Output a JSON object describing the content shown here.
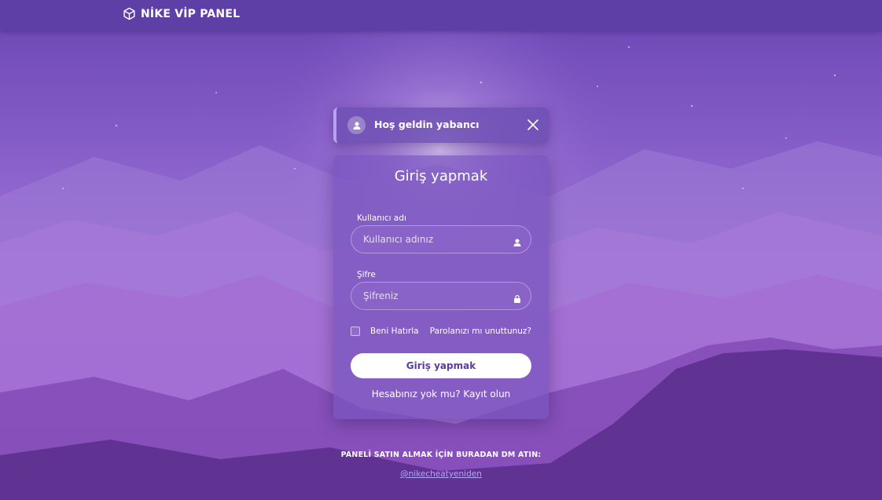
{
  "app": {
    "brand": "NİKE VİP PANEL"
  },
  "toast": {
    "message": "Hoş geldin yabancı"
  },
  "login": {
    "title": "Giriş yapmak",
    "username_label": "Kullanıcı adı",
    "username_placeholder": "Kullanıcı adınız",
    "username_value": "",
    "password_label": "Şifre",
    "password_placeholder": "Şifreniz",
    "password_value": "",
    "remember_label": "Beni Hatırla",
    "remember_checked": false,
    "forgot_label": "Parolanızı mı unuttunuz?",
    "submit_label": "Giriş yapmak",
    "register_label": "Hesabınız yok mu? Kayıt olun"
  },
  "footer": {
    "note": "PANELİ SATIN ALMAK İÇİN BURADAN DM ATIN:",
    "link": "@nikecheatyeniden"
  },
  "icons": {
    "brand": "cube-icon",
    "toast_avatar": "user-icon",
    "toast_close": "close-icon",
    "username_field": "user-icon",
    "password_field": "lock-icon"
  },
  "colors": {
    "topbar": "#5e3fa6",
    "accent": "#b7a1f0",
    "button_text": "#5b3ba0",
    "link": "#b6a7ff"
  }
}
